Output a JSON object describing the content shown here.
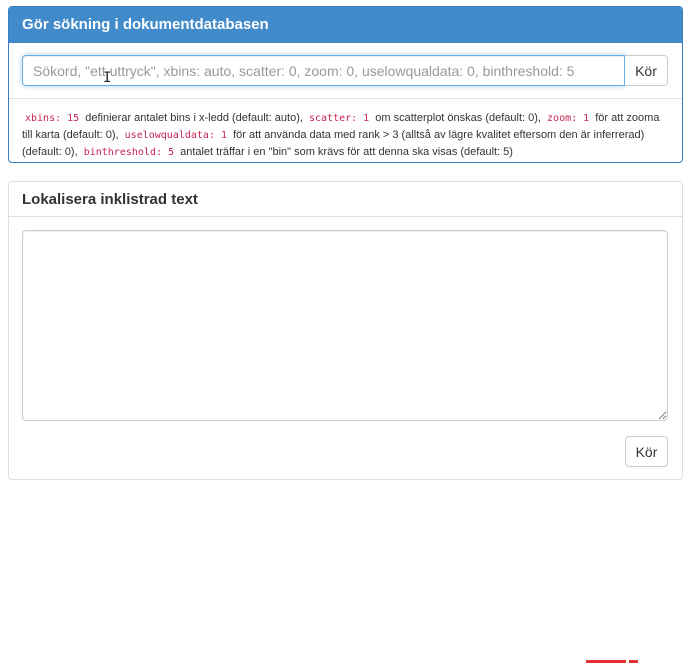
{
  "search_panel": {
    "title": "Gör sökning i dokumentdatabasen",
    "input_placeholder": "Sökord, \"ett uttryck\", xbins: auto, scatter: 0, zoom: 0, uselowqualdata: 0, binthreshold: 5",
    "input_value": "",
    "button_label": "Kör",
    "help": {
      "xbins_code": "xbins: 15",
      "xbins_text": "definierar antalet bins i x-ledd (default: auto),",
      "scatter_code": "scatter: 1",
      "scatter_text": "om scatterplot önskas (default: 0),",
      "zoom_code": "zoom: 1",
      "zoom_text": "för att zooma till karta (default: 0),",
      "lowqual_code": "uselowqualdata: 1",
      "lowqual_text": "för att använda data med rank > 3 (alltså av lägre kvalitet eftersom den är inferrerad) (default: 0),",
      "binthreshold_code": "binthreshold: 5",
      "binthreshold_text": "antalet träffar i en \"bin\" som krävs för att denna ska visas (default: 5)"
    }
  },
  "paste_panel": {
    "title": "Lokalisera inklistrad text",
    "textarea_value": "",
    "button_label": "Kör"
  },
  "icons": {
    "cursor": "text-cursor-icon"
  },
  "colors": {
    "primary": "#428bca",
    "code": "#c7254e",
    "mark": "#e0312f"
  }
}
